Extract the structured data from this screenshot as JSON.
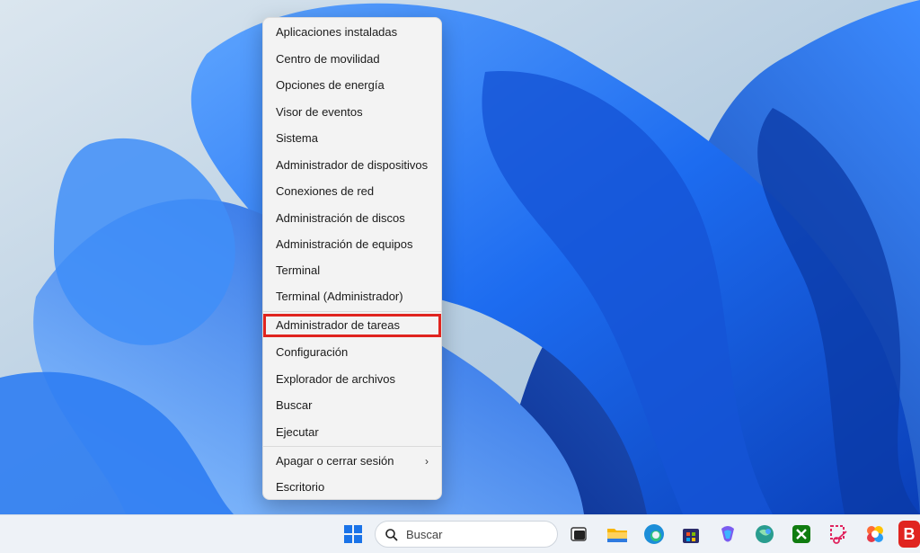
{
  "menu": {
    "items": [
      {
        "label": "Aplicaciones instaladas"
      },
      {
        "label": "Centro de movilidad"
      },
      {
        "label": "Opciones de energía"
      },
      {
        "label": "Visor de eventos"
      },
      {
        "label": "Sistema"
      },
      {
        "label": "Administrador de dispositivos"
      },
      {
        "label": "Conexiones de red"
      },
      {
        "label": "Administración de discos"
      },
      {
        "label": "Administración de equipos"
      },
      {
        "label": "Terminal"
      },
      {
        "label": "Terminal (Administrador)"
      },
      {
        "label": "Administrador de tareas"
      },
      {
        "label": "Configuración"
      },
      {
        "label": "Explorador de archivos"
      },
      {
        "label": "Buscar"
      },
      {
        "label": "Ejecutar"
      },
      {
        "label": "Apagar o cerrar sesión"
      },
      {
        "label": "Escritorio"
      }
    ],
    "highlighted": "Administrador de tareas",
    "highlight_color": "#e0241f"
  },
  "taskbar": {
    "search_placeholder": "Buscar",
    "icons": [
      "start-icon",
      "search-icon",
      "task-view-icon",
      "file-explorer-icon",
      "edge-icon",
      "store-icon",
      "copilot-icon",
      "maps-icon",
      "xbox-icon",
      "snipping-tool-icon",
      "photos-icon",
      "brave-icon"
    ],
    "brave_letter": "B"
  },
  "colors": {
    "accent": "#0a5fd6",
    "wallpaper_bg": "#c9dbe9"
  }
}
